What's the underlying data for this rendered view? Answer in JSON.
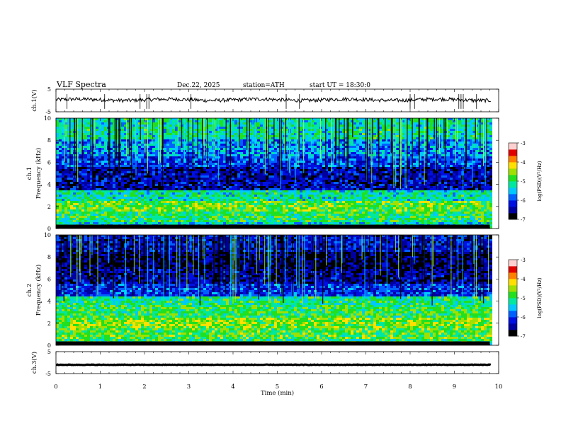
{
  "header": {
    "title": "VLF  Spectra",
    "date": "Dec.22, 2025",
    "station": "station=ATH",
    "start": "start  UT  =   18:30:0"
  },
  "colors": {
    "colormap": [
      "#000000",
      "#0000a0",
      "#0010e0",
      "#0060ff",
      "#00c8ff",
      "#00e8a0",
      "#20e020",
      "#a0e000",
      "#ffe000",
      "#ff8000",
      "#e00000",
      "#ffd0d0"
    ],
    "line": "#000000"
  },
  "chart_data": [
    {
      "type": "line",
      "panel": "ch1-waveform",
      "ylabel": "ch.1(V)",
      "ylim": [
        -5,
        5
      ],
      "yticks": [
        {
          "v": 5,
          "label": "5"
        },
        {
          "v": -5,
          "label": "-5"
        }
      ],
      "xlim": [
        0,
        10
      ],
      "level": 0.3,
      "spike_times": [
        0.25,
        1.1,
        1.9,
        2.05,
        2.1,
        3.05,
        5.2,
        5.5,
        8.0,
        8.1,
        9.1,
        9.15,
        9.2,
        9.5
      ]
    },
    {
      "type": "heatmap",
      "panel": "ch1-spectrogram",
      "xlabel": "",
      "ylabel": "Frequency  (kHz)",
      "channel_label": "ch.1",
      "ylim": [
        0,
        10
      ],
      "xlim": [
        0,
        9.8
      ],
      "yticks": [
        {
          "v": 0,
          "label": "0"
        },
        {
          "v": 2,
          "label": "2"
        },
        {
          "v": 4,
          "label": "4"
        },
        {
          "v": 6,
          "label": "6"
        },
        {
          "v": 8,
          "label": "8"
        },
        {
          "v": 10,
          "label": "10"
        }
      ],
      "colorbar": {
        "label": "log(PSD)(V²/Hz)",
        "range": [
          -7,
          -3
        ],
        "ticks": [
          {
            "v": -3,
            "label": "-3"
          },
          {
            "v": -4,
            "label": "-4"
          },
          {
            "v": -5,
            "label": "-5"
          },
          {
            "v": -6,
            "label": "-6"
          },
          {
            "v": -7,
            "label": "-7"
          }
        ]
      },
      "bands": [
        {
          "f0": 0.0,
          "f1": 0.5,
          "level": -5.4
        },
        {
          "f0": 0.5,
          "f1": 1.5,
          "level": -5.0
        },
        {
          "f0": 1.5,
          "f1": 2.5,
          "level": -4.7
        },
        {
          "f0": 2.5,
          "f1": 3.5,
          "level": -5.2
        },
        {
          "f0": 3.5,
          "f1": 5.5,
          "level": -6.4
        },
        {
          "f0": 5.5,
          "f1": 6.5,
          "level": -6.0
        },
        {
          "f0": 6.5,
          "f1": 8.0,
          "level": -5.7
        },
        {
          "f0": 8.0,
          "f1": 10.0,
          "level": -5.2
        }
      ]
    },
    {
      "type": "heatmap",
      "panel": "ch2-spectrogram",
      "xlabel": "",
      "ylabel": "Frequency  (kHz)",
      "channel_label": "ch.2",
      "ylim": [
        0,
        10
      ],
      "xlim": [
        0,
        9.8
      ],
      "yticks": [
        {
          "v": 0,
          "label": "0"
        },
        {
          "v": 2,
          "label": "2"
        },
        {
          "v": 4,
          "label": "4"
        },
        {
          "v": 6,
          "label": "6"
        },
        {
          "v": 8,
          "label": "8"
        },
        {
          "v": 10,
          "label": "10"
        }
      ],
      "colorbar": {
        "label": "log(PSD)(V²/Hz)",
        "range": [
          -7,
          -3
        ],
        "ticks": [
          {
            "v": -3,
            "label": "-3"
          },
          {
            "v": -4,
            "label": "-4"
          },
          {
            "v": -5,
            "label": "-5"
          },
          {
            "v": -6,
            "label": "-6"
          },
          {
            "v": -7,
            "label": "-7"
          }
        ]
      },
      "bands": [
        {
          "f0": 0.0,
          "f1": 0.5,
          "level": -5.0
        },
        {
          "f0": 0.5,
          "f1": 1.5,
          "level": -4.8
        },
        {
          "f0": 1.5,
          "f1": 2.5,
          "level": -4.6
        },
        {
          "f0": 2.5,
          "f1": 3.6,
          "level": -4.9
        },
        {
          "f0": 3.6,
          "f1": 4.4,
          "level": -5.1
        },
        {
          "f0": 4.4,
          "f1": 5.5,
          "level": -6.1
        },
        {
          "f0": 5.5,
          "f1": 7.0,
          "level": -6.5
        },
        {
          "f0": 7.0,
          "f1": 8.5,
          "level": -6.7
        },
        {
          "f0": 8.5,
          "f1": 10.0,
          "level": -6.3
        }
      ]
    },
    {
      "type": "line",
      "panel": "ch3-waveform",
      "ylabel": "ch.3(V)",
      "xlabel": "Time  (min)",
      "ylim": [
        -5,
        5
      ],
      "yticks": [
        {
          "v": 5,
          "label": "5"
        },
        {
          "v": -5,
          "label": "-5"
        }
      ],
      "xlim": [
        0,
        10
      ],
      "xticks": [
        {
          "v": 0,
          "label": "0"
        },
        {
          "v": 1,
          "label": "1"
        },
        {
          "v": 2,
          "label": "2"
        },
        {
          "v": 3,
          "label": "3"
        },
        {
          "v": 4,
          "label": "4"
        },
        {
          "v": 5,
          "label": "5"
        },
        {
          "v": 6,
          "label": "6"
        },
        {
          "v": 7,
          "label": "7"
        },
        {
          "v": 8,
          "label": "8"
        },
        {
          "v": 9,
          "label": "9"
        },
        {
          "v": 10,
          "label": "10"
        }
      ],
      "level": -1.0
    }
  ]
}
